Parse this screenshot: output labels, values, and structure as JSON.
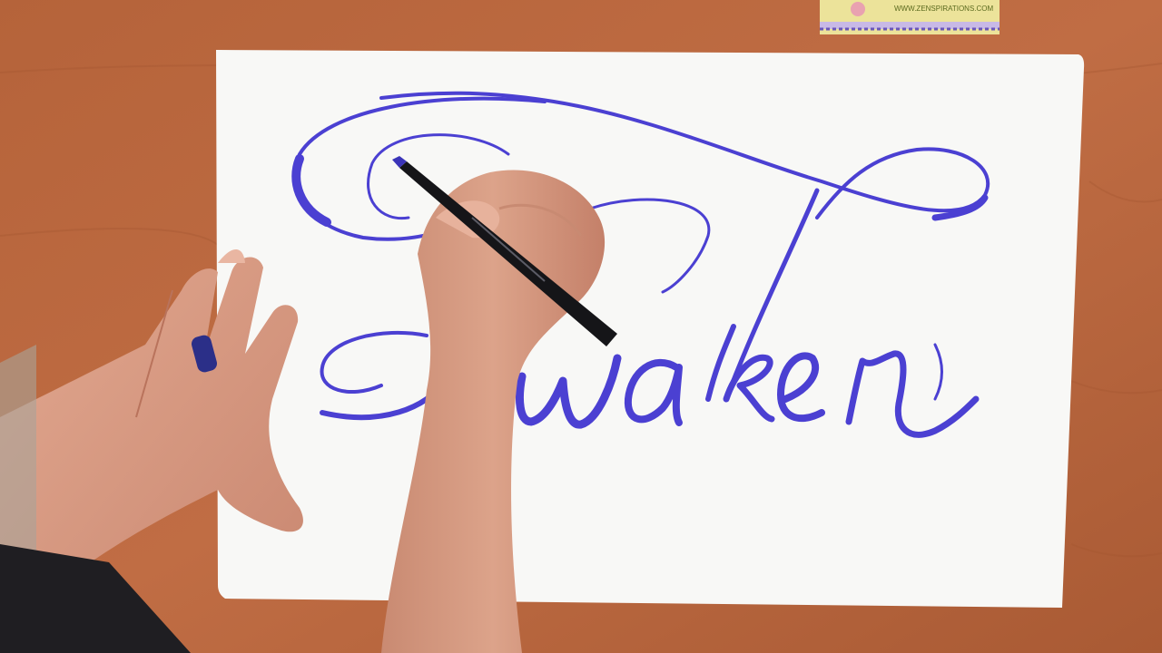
{
  "scene": {
    "description_word": "Awaken",
    "card": {
      "url_text": "WWW.ZENSPIRATIONS.COM"
    },
    "colors": {
      "desk": "#b8643a",
      "paper": "#f7f7f5",
      "ink": "#4a3fd0",
      "skin": "#d99b82",
      "card": "#eee39a"
    }
  }
}
